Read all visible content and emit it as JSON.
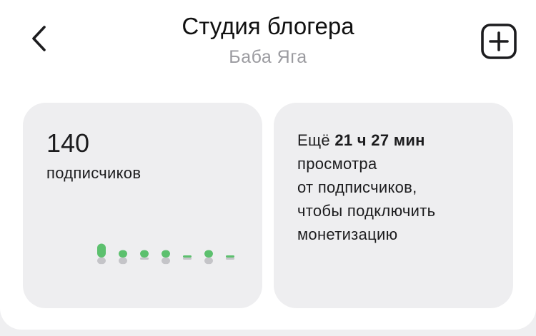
{
  "header": {
    "title": "Студия блогера",
    "subtitle": "Баба Яга",
    "back_icon": "chevron-left-icon",
    "add_icon": "plus-square-icon"
  },
  "subscribers": {
    "count": "140",
    "label": "подписчиков",
    "trend": {
      "type": "bar",
      "colors": {
        "up": "#5cc06e",
        "down": "#c4c4c8"
      },
      "up": [
        3,
        1.6,
        1.6,
        1.6,
        0.4,
        1.6,
        0.4
      ],
      "down": [
        1.4,
        1.4,
        0.4,
        1.4,
        0.4,
        1.4,
        0.4
      ]
    }
  },
  "monetization": {
    "prefix": "Ещё ",
    "time": "21 ч 27 мин",
    "line2": "просмотра",
    "line3": "от подписчиков,",
    "line4": "чтобы подключить",
    "line5": "монетизацию"
  }
}
